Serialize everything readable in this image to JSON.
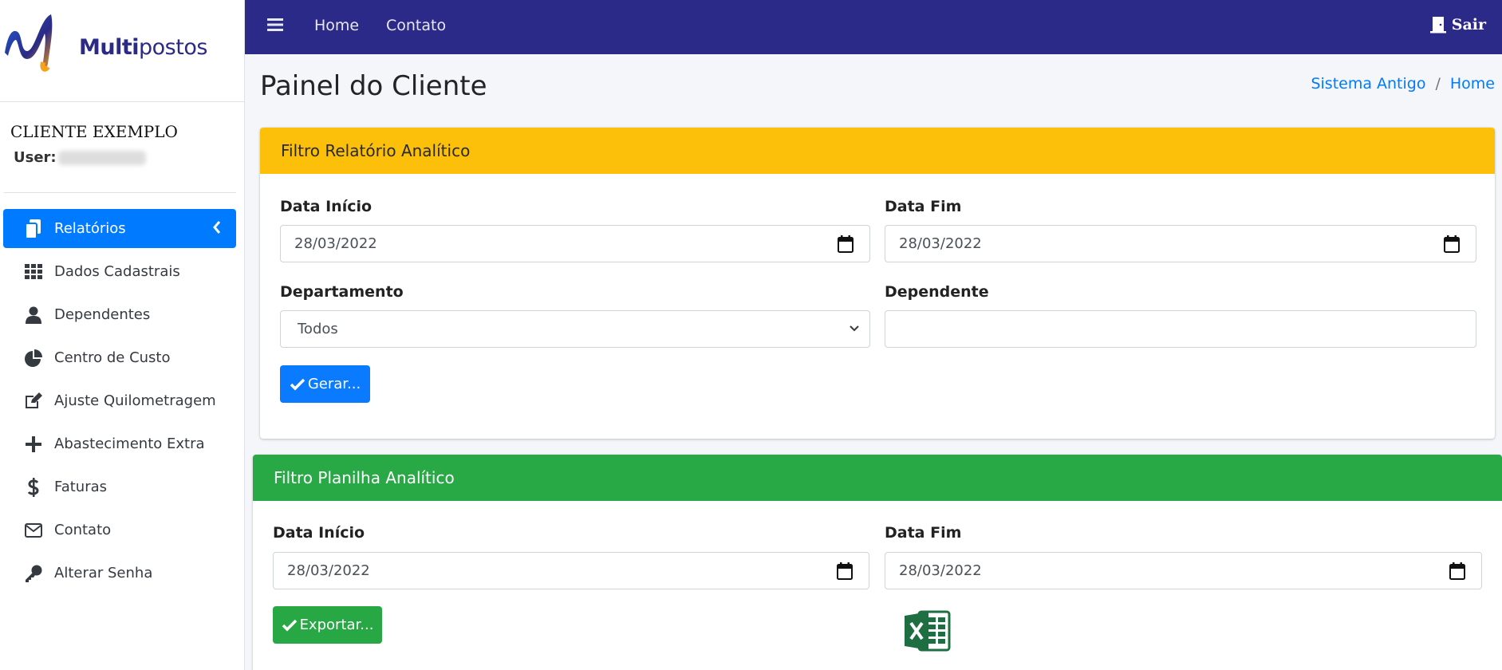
{
  "brand": {
    "bold": "Multi",
    "regular": "postos",
    "logo_icon": "multipostos-logo"
  },
  "user": {
    "client_name": "CLIENTE EXEMPLO",
    "label": "User:"
  },
  "sidebar": {
    "items": [
      {
        "label": "Relatórios",
        "icon": "copy-icon",
        "active": true
      },
      {
        "label": "Dados Cadastrais",
        "icon": "grid-icon"
      },
      {
        "label": "Dependentes",
        "icon": "user-icon"
      },
      {
        "label": "Centro de Custo",
        "icon": "pie-chart-icon"
      },
      {
        "label": "Ajuste Quilometragem",
        "icon": "edit-icon"
      },
      {
        "label": "Abastecimento Extra",
        "icon": "plus-icon"
      },
      {
        "label": "Faturas",
        "icon": "dollar-icon"
      },
      {
        "label": "Contato",
        "icon": "envelope-icon"
      },
      {
        "label": "Alterar Senha",
        "icon": "key-icon"
      }
    ]
  },
  "topbar": {
    "home": "Home",
    "contact": "Contato",
    "logout": "Sair"
  },
  "page": {
    "title": "Painel do Cliente"
  },
  "breadcrumb": {
    "item1": "Sistema Antigo",
    "separator": "/",
    "item2": "Home"
  },
  "report_filter": {
    "header": "Filtro Relatório Analítico",
    "start_label": "Data Início",
    "start_value": "28/03/2022",
    "end_label": "Data Fim",
    "end_value": "28/03/2022",
    "department_label": "Departamento",
    "department_value": "Todos",
    "dependent_label": "Dependente",
    "dependent_value": "",
    "button": "Gerar..."
  },
  "sheet_filter": {
    "header": "Filtro Planilha Analítico",
    "start_label": "Data Início",
    "start_value": "28/03/2022",
    "end_label": "Data Fim",
    "end_value": "28/03/2022",
    "button": "Exportar...",
    "excel_icon": "excel-icon"
  },
  "colors": {
    "topbar": "#2b2a88",
    "active": "#007bff",
    "warning": "#fcbf0a",
    "success": "#29a846"
  }
}
